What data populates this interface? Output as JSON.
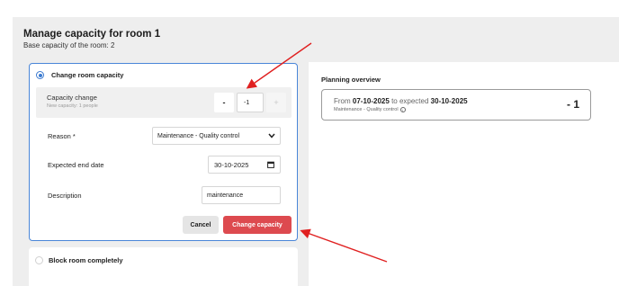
{
  "header": {
    "title": "Manage capacity for room 1",
    "subtitle": "Base capacity of the room: 2"
  },
  "change_option": {
    "label": "Change room capacity",
    "selected": true,
    "capacity_change_label": "Capacity change",
    "new_capacity_text": "New capacity: 1 people",
    "decrement_symbol": "-",
    "increment_symbol": "+",
    "value": "-1",
    "reason_label": "Reason *",
    "reason_value": "Maintenance - Quality control",
    "end_date_label": "Expected end date",
    "end_date_value": "30-10-2025",
    "description_label": "Description",
    "description_value": "maintenance",
    "cancel_label": "Cancel",
    "confirm_label": "Change capacity"
  },
  "block_option": {
    "label": "Block room completely",
    "selected": false
  },
  "overview": {
    "title": "Planning overview",
    "from_text": "From",
    "from_date": "07-10-2025",
    "to_text": "to expected",
    "to_date": "30-10-2025",
    "reason": "Maintenance - Quality control",
    "delta": "- 1"
  },
  "icons": {
    "select_chevron": "chevron-down-icon",
    "calendar": "calendar-icon",
    "info": "info-icon"
  },
  "colors": {
    "accent_blue": "#4a86d8",
    "danger_red": "#dd4a4f",
    "annotation_red": "#e02020"
  }
}
